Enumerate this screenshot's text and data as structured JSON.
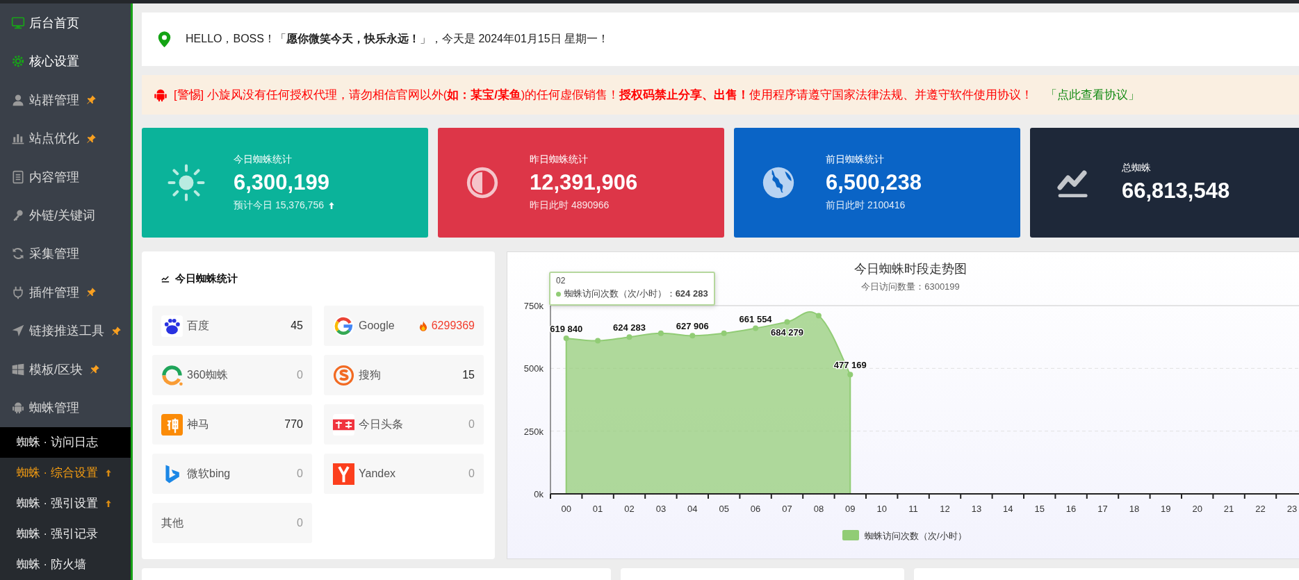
{
  "sidebar": {
    "items": [
      {
        "label": "后台首页",
        "active": true,
        "pinned": false
      },
      {
        "label": "核心设置",
        "active": true,
        "pinned": false
      },
      {
        "label": "站群管理",
        "active": false,
        "pinned": true
      },
      {
        "label": "站点优化",
        "active": false,
        "pinned": true
      },
      {
        "label": "内容管理",
        "active": false,
        "pinned": false
      },
      {
        "label": "外链/关键词",
        "active": false,
        "pinned": false
      },
      {
        "label": "采集管理",
        "active": false,
        "pinned": false
      },
      {
        "label": "插件管理",
        "active": false,
        "pinned": true
      },
      {
        "label": "链接推送工具",
        "active": false,
        "pinned": true
      },
      {
        "label": "模板/区块",
        "active": false,
        "pinned": true
      },
      {
        "label": "蜘蛛管理",
        "active": false,
        "pinned": false,
        "expanded": true,
        "children": [
          {
            "label": "蜘蛛 · 访问日志",
            "selected": true,
            "highlighted": false,
            "arrow": false
          },
          {
            "label": "蜘蛛 · 综合设置",
            "selected": false,
            "highlighted": true,
            "arrow": true
          },
          {
            "label": "蜘蛛 · 强引设置",
            "selected": false,
            "highlighted": false,
            "arrow": true
          },
          {
            "label": "蜘蛛 · 强引记录",
            "selected": false,
            "highlighted": false,
            "arrow": false
          },
          {
            "label": "蜘蛛 · 防火墙",
            "selected": false,
            "highlighted": false,
            "arrow": false
          }
        ]
      }
    ]
  },
  "greeting": "HELLO，BOSS！「**愿你微笑今天，快乐永远！**」，今天是 2024年01月15日 星期一！",
  "warning": {
    "text": "[警惕] 小旋风没有任何授权代理，请勿相信官网以外(**如：某宝/某鱼**)的任何虚假销售！**授权码禁止分享、出售！**使用程序请遵守国家法律法规、并遵守软件使用协议！",
    "link": "「点此查看协议」"
  },
  "stat_cards": [
    {
      "title": "今日蜘蛛统计",
      "value": "6,300,199",
      "note": "预计今日 15,376,756",
      "trend_up": true,
      "color": "#0bb39a"
    },
    {
      "title": "昨日蜘蛛统计",
      "value": "12,391,906",
      "note": "昨日此时 4890966",
      "trend_up": false,
      "color": "#dd3648"
    },
    {
      "title": "前日蜘蛛统计",
      "value": "6,500,238",
      "note": "前日此时 2100416",
      "trend_up": false,
      "color": "#0a64c6"
    },
    {
      "title": "总蜘蛛",
      "value": "66,813,548",
      "color": "#1e2839"
    }
  ],
  "spider_stats": {
    "title": "今日蜘蛛统计",
    "items": [
      {
        "name": "百度",
        "count": "45",
        "muted": false,
        "hot": false
      },
      {
        "name": "Google",
        "count": "6299369",
        "muted": false,
        "hot": true
      },
      {
        "name": "360蜘蛛",
        "count": "0",
        "muted": true,
        "hot": false
      },
      {
        "name": "搜狗",
        "count": "15",
        "muted": false,
        "hot": false
      },
      {
        "name": "神马",
        "count": "770",
        "muted": false,
        "hot": false
      },
      {
        "name": "今日头条",
        "count": "0",
        "muted": true,
        "hot": false
      },
      {
        "name": "微软bing",
        "count": "0",
        "muted": true,
        "hot": false
      },
      {
        "name": "Yandex",
        "count": "0",
        "muted": true,
        "hot": false
      },
      {
        "name": "其他",
        "count": "0",
        "muted": true,
        "hot": false
      }
    ]
  },
  "trend": {
    "subtitle": "今日访问数量：6300199",
    "tooltip": {
      "title": "02",
      "text": "蜘蛛访问次数（次/小时）：**624 283**"
    },
    "chart_data": {
      "type": "area",
      "title": "今日蜘蛛时段走势图",
      "categories": [
        "00",
        "01",
        "02",
        "03",
        "04",
        "05",
        "06",
        "07",
        "08",
        "09",
        "10",
        "11",
        "12",
        "13",
        "14",
        "15",
        "16",
        "17",
        "18",
        "19",
        "20",
        "21",
        "22",
        "23"
      ],
      "series": [
        {
          "name": "蜘蛛访问次数（次/小时）",
          "color": "#91cc75",
          "values": [
            620000,
            610000,
            625000,
            640000,
            630000,
            640000,
            660000,
            685000,
            710000,
            475000,
            null,
            null,
            null,
            null,
            null,
            null,
            null,
            null,
            null,
            null,
            null,
            null,
            null,
            null
          ]
        }
      ],
      "value_labels": [
        "619 840",
        null,
        "624 283",
        null,
        "627 906",
        null,
        "661 554",
        "684 279",
        null,
        "477 169",
        null,
        null,
        null,
        null,
        null,
        null,
        null,
        null,
        null,
        null,
        null,
        null,
        null,
        null
      ],
      "ylim": [
        0,
        750000
      ],
      "yticks": [
        {
          "value": 0,
          "label": "0k"
        },
        {
          "value": 250000,
          "label": "250k"
        },
        {
          "value": 500000,
          "label": "500k"
        },
        {
          "value": 750000,
          "label": "750k"
        }
      ]
    }
  }
}
